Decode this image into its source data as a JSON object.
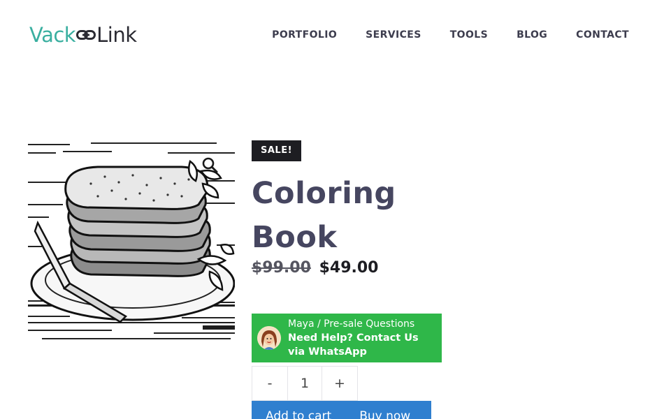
{
  "logo": {
    "part1": "Vack",
    "part2": "Link"
  },
  "nav": [
    "PORTFOLIO",
    "SERVICES",
    "TOOLS",
    "BLOG",
    "CONTACT"
  ],
  "product": {
    "badge": "SALE!",
    "title": "Coloring Book",
    "old_price": "$99.00",
    "price": "$49.00"
  },
  "whatsapp": {
    "subtitle": "Maya / Pre-sale Questions",
    "message": "Need Help? Contact Us via WhatsApp"
  },
  "quantity": {
    "minus": "-",
    "value": "1",
    "plus": "+"
  },
  "actions": {
    "add_to_cart": "Add to cart",
    "buy_now": "Buy now"
  },
  "icons": {
    "logo_link": "link-chain-icon",
    "zoom": "magnifier-icon",
    "avatar": "support-agent-avatar"
  },
  "colors": {
    "logo_accent": "#3aafa0",
    "title": "#464660",
    "whatsapp_green": "#2fb749",
    "button_blue": "#2f7fcf",
    "badge_bg": "#1d1d22"
  }
}
